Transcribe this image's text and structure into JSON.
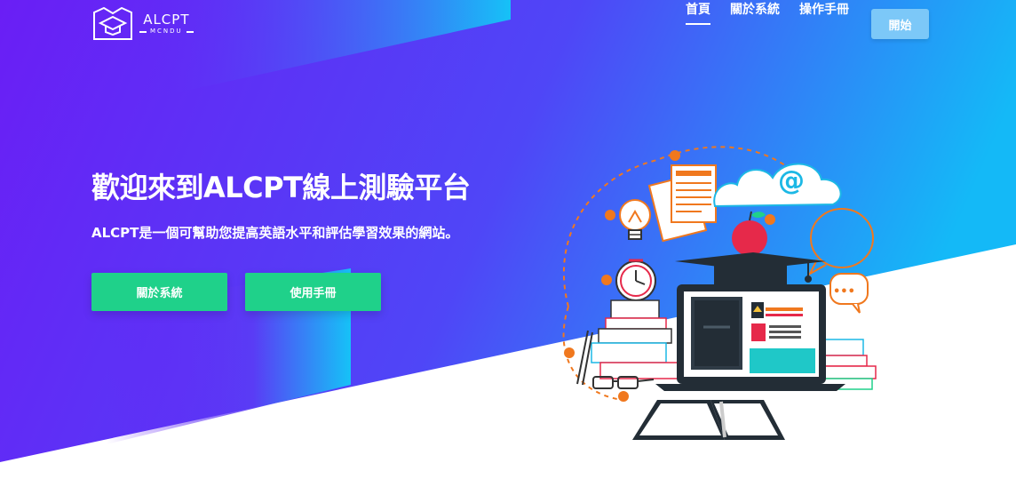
{
  "brand": {
    "name": "ALCPT",
    "sub": "MCNDU"
  },
  "nav": {
    "items": [
      {
        "label": "首頁",
        "active": true
      },
      {
        "label": "關於系統",
        "active": false
      },
      {
        "label": "操作手冊",
        "active": false
      }
    ],
    "start_label": "開始"
  },
  "hero": {
    "title": "歡迎來到ALCPT線上測驗平台",
    "subtitle": "ALCPT是一個可幫助您提高英語水平和評估學習效果的網站。",
    "buttons": [
      "關於系統",
      "使用手冊"
    ]
  },
  "illustration": {
    "cloud_symbol": "@",
    "bubble_symbol": "•••"
  },
  "colors": {
    "gradient_start": "#6a1ef5",
    "gradient_mid": "#4f46f7",
    "gradient_end": "#0fbff7",
    "accent_green": "#1fd18a",
    "start_button": "#7cc8f8",
    "orange": "#f0781e"
  }
}
